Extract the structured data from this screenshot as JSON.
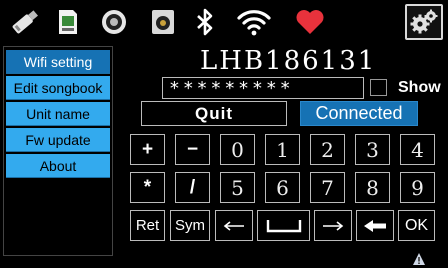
{
  "sidebar": {
    "items": [
      {
        "label": "Wifi setting",
        "active": true
      },
      {
        "label": "Edit songbook",
        "active": false
      },
      {
        "label": "Unit name",
        "active": false
      },
      {
        "label": "Fw update",
        "active": false
      },
      {
        "label": "About",
        "active": false
      }
    ]
  },
  "wifi": {
    "device_name": "LHB186131",
    "password_masked": "*********",
    "show_label": "Show",
    "quit_label": "Quit",
    "status_label": "Connected"
  },
  "keyboard": {
    "row1": [
      "+",
      "−",
      "0",
      "1",
      "2",
      "3",
      "4"
    ],
    "row2": [
      "*",
      "/",
      "5",
      "6",
      "7",
      "8",
      "9"
    ],
    "row3": [
      "Ret",
      "Sym",
      "←",
      "␣",
      "→",
      "⟵",
      "OK"
    ]
  },
  "colors": {
    "accent": "#33aaee",
    "active_tab": "#1672b4",
    "heart": "#e8323c"
  },
  "icons": [
    "usb-stick-icon",
    "sd-card-icon",
    "speaker-icon",
    "speaker-box-icon",
    "bluetooth-icon",
    "wifi-icon",
    "heart-icon",
    "settings-gears-icon",
    "warning-icon"
  ]
}
